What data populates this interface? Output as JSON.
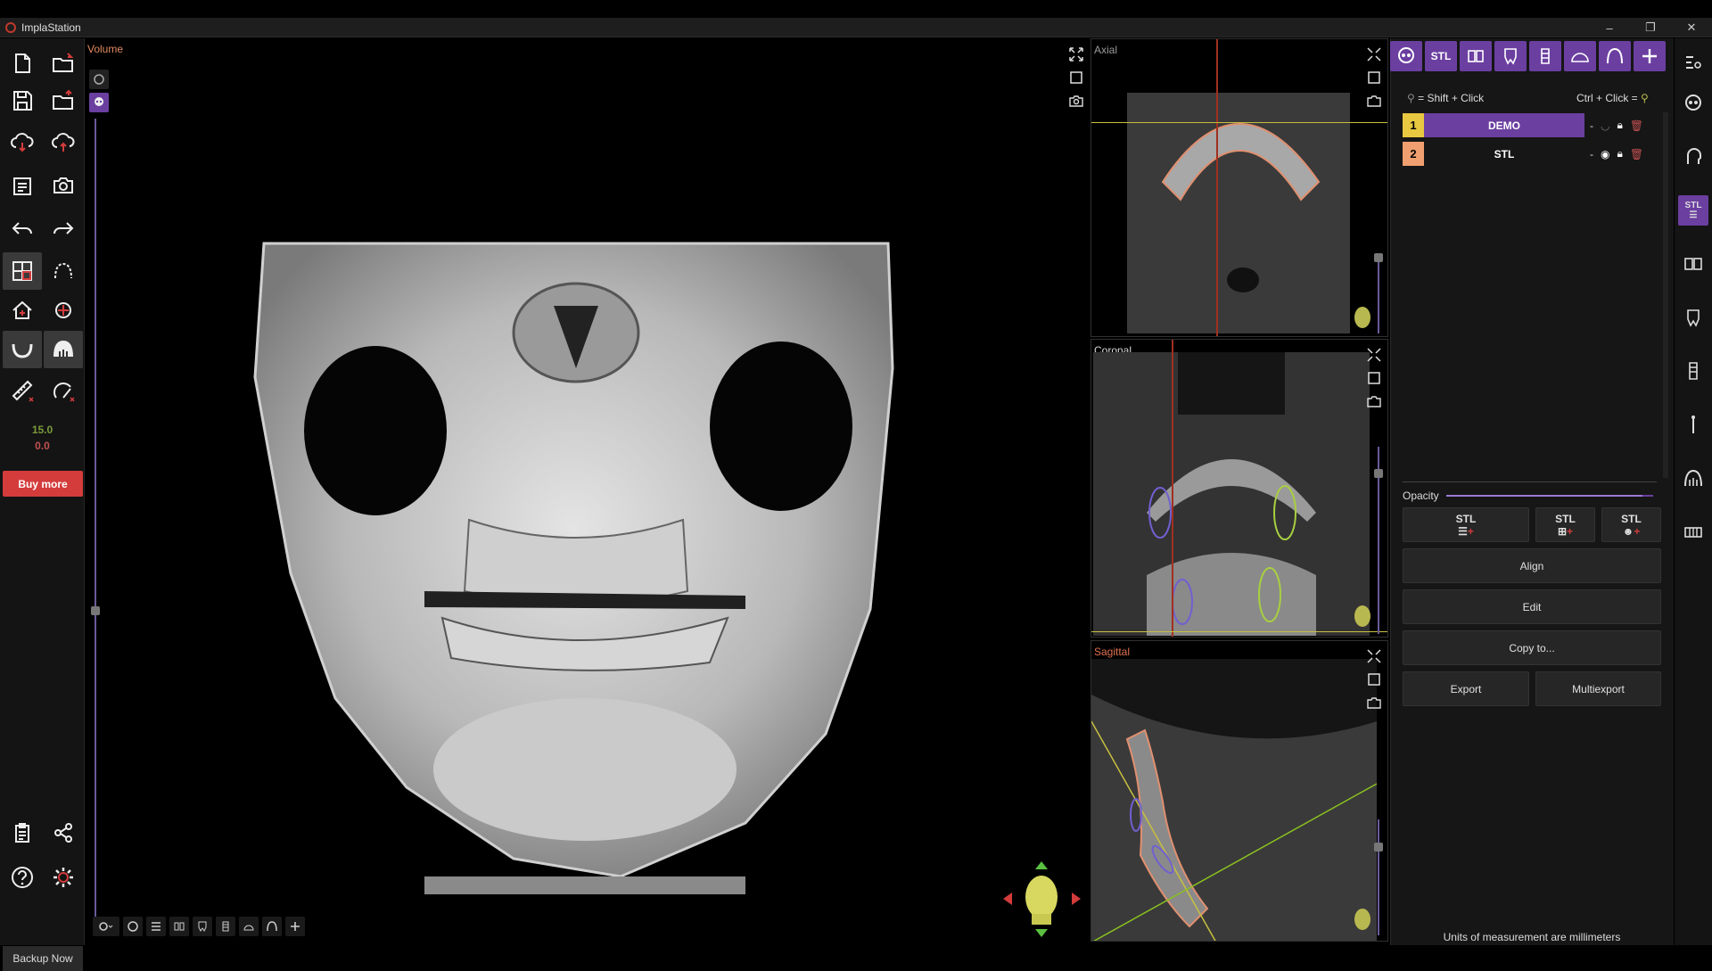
{
  "window": {
    "title": "ImplaStation",
    "controls": [
      "–",
      "❐",
      "✕"
    ]
  },
  "left_toolbar": {
    "value_green": "15.0",
    "value_red": "0.0",
    "buy_more": "Buy more",
    "backup_now": "Backup Now"
  },
  "views": {
    "volume": "Volume",
    "axial": "Axial",
    "coronal": "Coronal",
    "sagittal": "Sagittal"
  },
  "right_panel": {
    "toolbar_stl": "STL",
    "legend_left": "= Shift + Click",
    "legend_right": "Ctrl  + Click =",
    "objects": [
      {
        "num": "1",
        "name": "DEMO",
        "dash": "-",
        "num_color": "#e8c840",
        "name_bg": "#6b3fa0"
      },
      {
        "num": "2",
        "name": "STL",
        "dash": "-",
        "num_color": "#f0a070",
        "name_bg": "#161616"
      }
    ],
    "opacity_label": "Opacity",
    "opacity_value": 0.95,
    "stl_buttons": [
      "STL",
      "STL",
      "STL"
    ],
    "align": "Align",
    "edit": "Edit",
    "copy_to": "Copy to...",
    "export": "Export",
    "multiexport": "Multiexport",
    "units": "Units of measurement are millimeters",
    "farright_stl": "STL"
  },
  "colors": {
    "accent": "#6b3fa0",
    "buy_more": "#d43c3c",
    "green_value": "#7a9a3a",
    "red_value": "#c05050",
    "coronal_label": "#d8d8d8",
    "sagittal_label": "#e07050",
    "volume_label": "#e08a60"
  }
}
